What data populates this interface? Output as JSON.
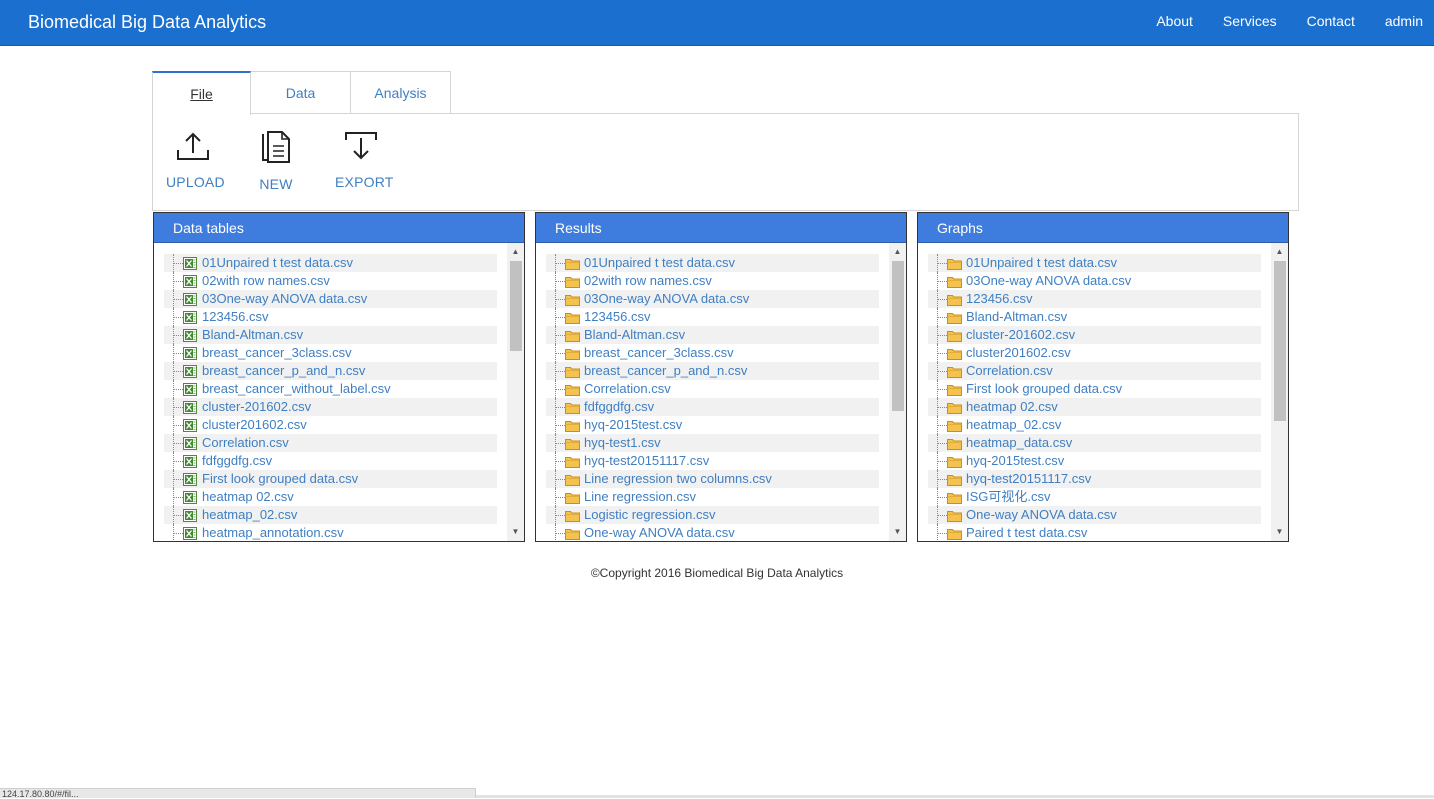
{
  "navbar": {
    "brand": "Biomedical Big Data Analytics",
    "links": [
      "About",
      "Services",
      "Contact",
      "admin"
    ],
    "color": "#1a6fcf"
  },
  "tabs": [
    {
      "label": "File",
      "active": true
    },
    {
      "label": "Data",
      "active": false
    },
    {
      "label": "Analysis",
      "active": false
    }
  ],
  "toolbar": {
    "upload_label": "UPLOAD",
    "new_label": "NEW",
    "export_label": "EXPORT"
  },
  "panels": {
    "data_tables": {
      "title": "Data tables",
      "icon": "csv-file-icon",
      "items": [
        "01Unpaired t test data.csv",
        "02with row names.csv",
        "03One-way ANOVA data.csv",
        "123456.csv",
        "Bland-Altman.csv",
        "breast_cancer_3class.csv",
        "breast_cancer_p_and_n.csv",
        "breast_cancer_without_label.csv",
        "cluster-201602.csv",
        "cluster201602.csv",
        "Correlation.csv",
        "fdfggdfg.csv",
        "First look grouped data.csv",
        "heatmap 02.csv",
        "heatmap_02.csv",
        "heatmap_annotation.csv"
      ]
    },
    "results": {
      "title": "Results",
      "icon": "folder-icon",
      "items": [
        "01Unpaired t test data.csv",
        "02with row names.csv",
        "03One-way ANOVA data.csv",
        "123456.csv",
        "Bland-Altman.csv",
        "breast_cancer_3class.csv",
        "breast_cancer_p_and_n.csv",
        "Correlation.csv",
        "fdfggdfg.csv",
        "hyq-2015test.csv",
        "hyq-test1.csv",
        "hyq-test20151117.csv",
        "Line regression two columns.csv",
        "Line regression.csv",
        "Logistic regression.csv",
        "One-way ANOVA data.csv"
      ]
    },
    "graphs": {
      "title": "Graphs",
      "icon": "folder-icon",
      "items": [
        "01Unpaired t test data.csv",
        "03One-way ANOVA data.csv",
        "123456.csv",
        "Bland-Altman.csv",
        "cluster-201602.csv",
        "cluster201602.csv",
        "Correlation.csv",
        "First look grouped data.csv",
        "heatmap 02.csv",
        "heatmap_02.csv",
        "heatmap_data.csv",
        "hyq-2015test.csv",
        "hyq-test20151117.csv",
        "ISG可视化.csv",
        "One-way ANOVA data.csv",
        "Paired t test data.csv"
      ]
    }
  },
  "footer": {
    "copyright": "©Copyright 2016 Biomedical Big Data Analytics"
  },
  "status": {
    "url": "124.17.80.80/#/fil..."
  }
}
